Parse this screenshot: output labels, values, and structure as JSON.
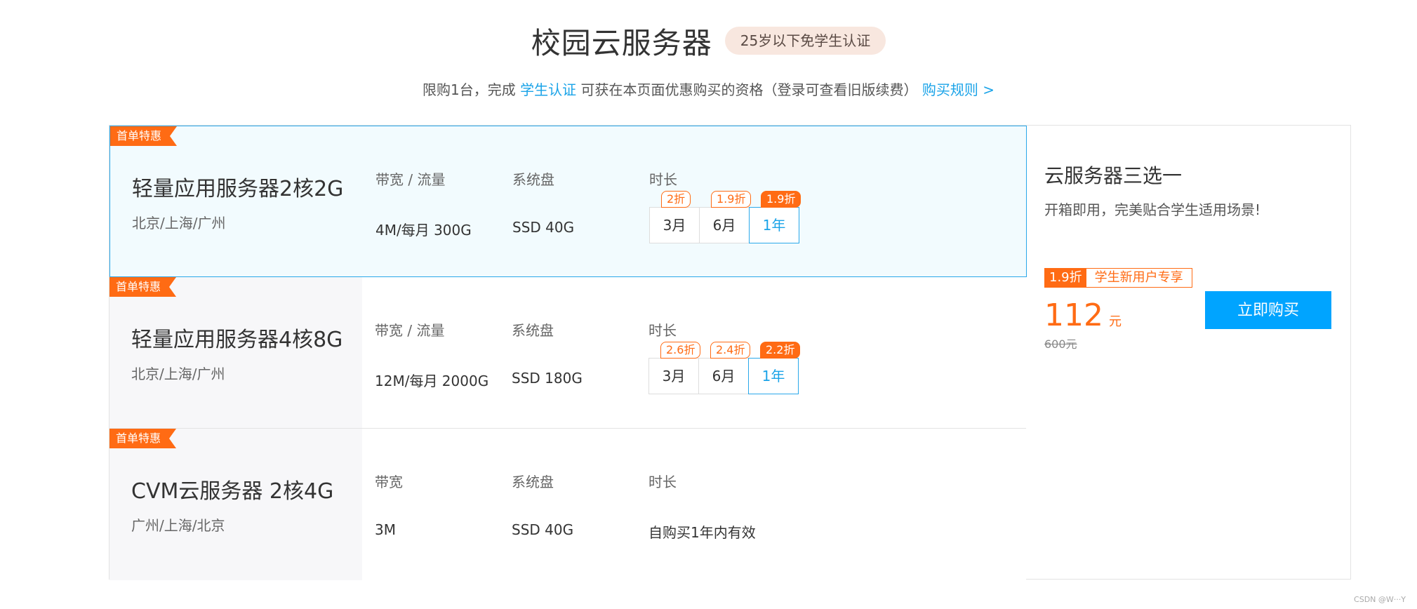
{
  "header": {
    "title": "校园云服务器",
    "badge": "25岁以下免学生认证",
    "sub_prefix": "限购1台，完成",
    "sub_link": "学生认证",
    "sub_middle": "可获在本页面优惠购买的资格（登录可查看旧版续费）",
    "rules_link": "购买规则 >"
  },
  "plans": [
    {
      "ribbon": "首单特惠",
      "name": "轻量应用服务器2核2G",
      "region": "北京/上海/广州",
      "bw_label": "带宽 / 流量",
      "bw_value": "4M/每月 300G",
      "disk_label": "系统盘",
      "disk_value": "SSD 40G",
      "dur_label": "时长",
      "durations": [
        {
          "label": "3月",
          "discount": "2折"
        },
        {
          "label": "6月",
          "discount": "1.9折"
        },
        {
          "label": "1年",
          "discount": "1.9折"
        }
      ]
    },
    {
      "ribbon": "首单特惠",
      "name": "轻量应用服务器4核8G",
      "region": "北京/上海/广州",
      "bw_label": "带宽 / 流量",
      "bw_value": "12M/每月 2000G",
      "disk_label": "系统盘",
      "disk_value": "SSD 180G",
      "dur_label": "时长",
      "durations": [
        {
          "label": "3月",
          "discount": "2.6折"
        },
        {
          "label": "6月",
          "discount": "2.4折"
        },
        {
          "label": "1年",
          "discount": "2.2折"
        }
      ]
    },
    {
      "ribbon": "首单特惠",
      "name": "CVM云服务器 2核4G",
      "region": "广州/上海/北京",
      "bw_label": "带宽",
      "bw_value": "3M",
      "disk_label": "系统盘",
      "disk_value": "SSD 40G",
      "dur_label": "时长",
      "dur_value": "自购买1年内有效"
    }
  ],
  "side": {
    "title": "云服务器三选一",
    "desc": "开箱即用，完美贴合学生适用场景!",
    "promo_discount": "1.9折",
    "promo_text": "学生新用户专享",
    "price": "112",
    "unit": "元",
    "original": "600元",
    "buy_label": "立即购买"
  },
  "watermark": "CSDN @W···Y",
  "colors": {
    "accent": "#1aa3e8",
    "orange": "#ff6b14",
    "buy": "#00a4ff"
  }
}
